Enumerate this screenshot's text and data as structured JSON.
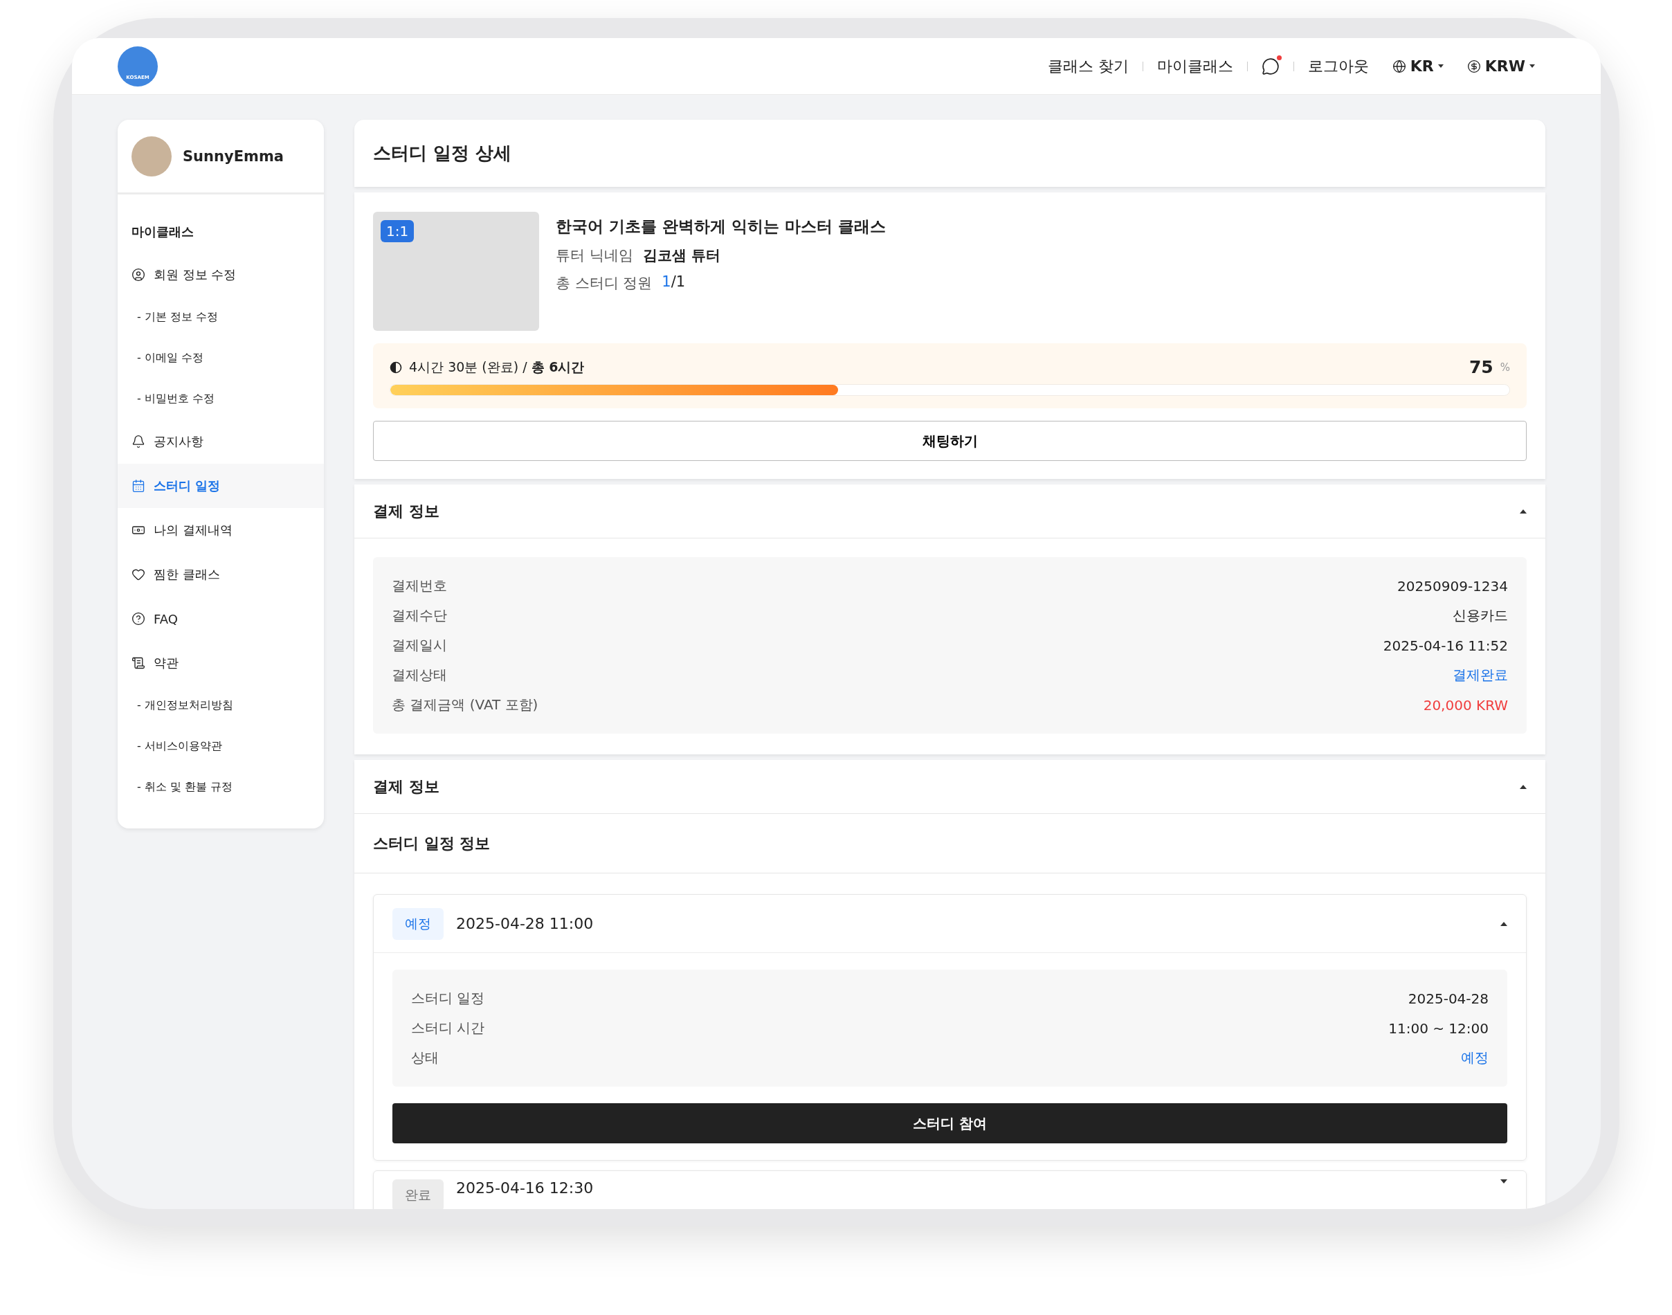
{
  "header": {
    "logo_text": "KOSAEM",
    "nav": [
      {
        "label": "클래스 찾기"
      },
      {
        "label": "마이클래스"
      }
    ],
    "chat_unread": true,
    "logout": "로그아웃",
    "language": "KR",
    "currency": "KRW"
  },
  "sidebar": {
    "user": "SunnyEmma",
    "section": "마이클래스",
    "items": [
      {
        "label": "회원 정보 수정",
        "selected": false,
        "children": [
          {
            "label": "- 기본 정보 수정",
            "selected": false
          },
          {
            "label": "- 이메일 수정",
            "selected": false
          },
          {
            "label": "- 비밀번호 수정",
            "selected": false
          }
        ]
      },
      {
        "label": "공지사항",
        "selected": false
      },
      {
        "label": "스터디 일정",
        "selected": true
      },
      {
        "label": "나의 결제내역",
        "selected": false
      },
      {
        "label": "찜한 클래스",
        "selected": false
      },
      {
        "label": "FAQ",
        "selected": false
      },
      {
        "label": "약관",
        "selected": false,
        "children": [
          {
            "label": "- 개인정보처리방침",
            "selected": false
          },
          {
            "label": "- 서비스이용약관",
            "selected": false
          },
          {
            "label": "- 취소 및 환불 규정",
            "selected": false
          }
        ]
      }
    ]
  },
  "page_title": "스터디 일정 상세",
  "class": {
    "badge": "1:1",
    "title": "한국어 기초를 완벽하게 익히는 마스터 클래스",
    "tutor_label": "튜터 닉네임",
    "tutor": "김코샘 튜터",
    "capacity_label": "총 스터디 정원",
    "capacity_current": "1",
    "capacity_total": "/1"
  },
  "progress": {
    "label": "4시간 30분 (완료) / **총 6시간**",
    "level": 0.4,
    "percent": "75",
    "unit": "%"
  },
  "chat_button": "채팅하기",
  "payment": {
    "title": "결제 정보",
    "expanded": true,
    "rows": [
      {
        "label": "결제번호",
        "value": "20250909-1234",
        "kind": "normal"
      },
      {
        "label": "결제수단",
        "value": "신용카드",
        "kind": "normal"
      },
      {
        "label": "결제일시",
        "value": "2025-04-16 11:52",
        "kind": "normal"
      },
      {
        "label": "결제상태",
        "value": "결제완료",
        "kind": "info"
      },
      {
        "label": "총 결제금액 (VAT 포함)",
        "value": "20,000 KRW",
        "kind": "alert"
      }
    ]
  },
  "schedule": {
    "title": "결제 정보",
    "expanded": true,
    "subtitle": "스터디 일정 정보",
    "sessions": [
      {
        "status": "예정",
        "kind": "upcoming",
        "datetime": "2025-04-28 11:00",
        "expanded": true,
        "rows": [
          {
            "label": "스터디 일정",
            "value": "2025-04-28",
            "kind": "normal"
          },
          {
            "label": "스터디 시간",
            "value": "11:00 ~ 12:00",
            "kind": "normal"
          },
          {
            "label": "상태",
            "value": "예정",
            "kind": "info"
          }
        ],
        "button": "스터디 참여"
      },
      {
        "status": "완료",
        "kind": "done",
        "datetime": "2025-04-16 12:30",
        "expanded": false
      }
    ]
  }
}
